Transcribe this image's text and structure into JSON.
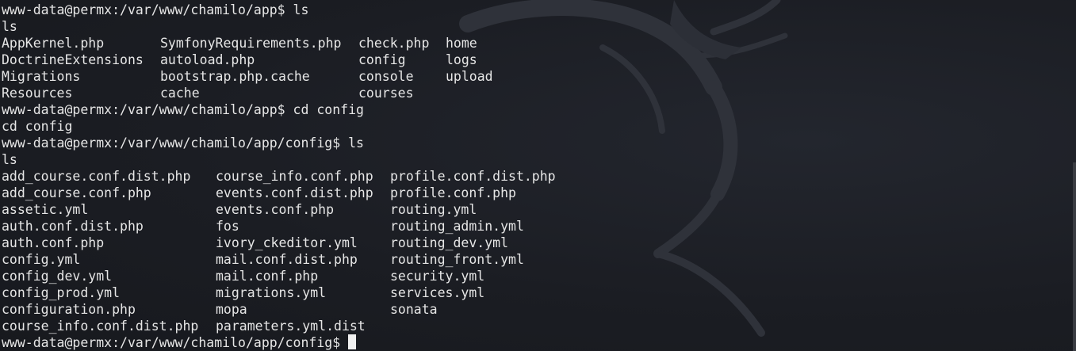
{
  "terminal": {
    "prompt1": "www-data@permx:/var/www/chamilo/app$ ls",
    "echo1": "ls",
    "ls_app": [
      [
        "AppKernel.php",
        "SymfonyRequirements.php",
        "check.php",
        "home"
      ],
      [
        "DoctrineExtensions",
        "autoload.php",
        "config",
        "logs"
      ],
      [
        "Migrations",
        "bootstrap.php.cache",
        "console",
        "upload"
      ],
      [
        "Resources",
        "cache",
        "courses",
        ""
      ]
    ],
    "prompt2": "www-data@permx:/var/www/chamilo/app$ cd config",
    "echo2": "cd config",
    "prompt3": "www-data@permx:/var/www/chamilo/app/config$ ls",
    "echo3": "ls",
    "ls_config": [
      [
        "add_course.conf.dist.php",
        "course_info.conf.php",
        "profile.conf.dist.php"
      ],
      [
        "add_course.conf.php",
        "events.conf.dist.php",
        "profile.conf.php"
      ],
      [
        "assetic.yml",
        "events.conf.php",
        "routing.yml"
      ],
      [
        "auth.conf.dist.php",
        "fos",
        "routing_admin.yml"
      ],
      [
        "auth.conf.php",
        "ivory_ckeditor.yml",
        "routing_dev.yml"
      ],
      [
        "config.yml",
        "mail.conf.dist.php",
        "routing_front.yml"
      ],
      [
        "config_dev.yml",
        "mail.conf.php",
        "security.yml"
      ],
      [
        "config_prod.yml",
        "migrations.yml",
        "services.yml"
      ],
      [
        "configuration.php",
        "mopa",
        "sonata"
      ],
      [
        "course_info.conf.dist.php",
        "parameters.yml.dist",
        ""
      ]
    ],
    "prompt4": "www-data@permx:/var/www/chamilo/app/config$"
  },
  "colors": {
    "background": "#1b1d23",
    "text": "#e6e6e6",
    "cursor": "#f0f0f0"
  },
  "icons": {
    "watermark": "kali-dragon-icon"
  }
}
